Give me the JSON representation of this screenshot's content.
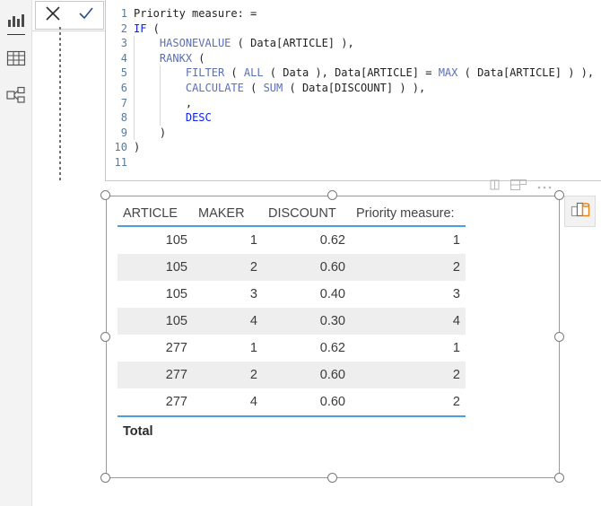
{
  "view_rail": {
    "items": [
      {
        "name": "report-view",
        "icon": "bar-chart-icon",
        "label": "Report",
        "selected": true
      },
      {
        "name": "data-view",
        "icon": "table-grid-icon",
        "label": "Data",
        "selected": false
      },
      {
        "name": "model-view",
        "icon": "model-relationships-icon",
        "label": "Model",
        "selected": false
      }
    ]
  },
  "formula_bar": {
    "cancel_label": "✕",
    "commit_label": "✓",
    "cancel_icon": "close-x-icon",
    "commit_icon": "checkmark-icon",
    "lines": [
      {
        "n": "1",
        "text": "Priority measure: ="
      },
      {
        "n": "2",
        "text": "IF ("
      },
      {
        "n": "3",
        "text": "    HASONEVALUE ( Data[ARTICLE] ),"
      },
      {
        "n": "4",
        "text": "    RANKX ("
      },
      {
        "n": "5",
        "text": "        FILTER ( ALL ( Data ), Data[ARTICLE] = MAX ( Data[ARTICLE] ) ),"
      },
      {
        "n": "6",
        "text": "        CALCULATE ( SUM ( Data[DISCOUNT] ) ),"
      },
      {
        "n": "7",
        "text": "        ,"
      },
      {
        "n": "8",
        "text": "        DESC"
      },
      {
        "n": "9",
        "text": "    )"
      },
      {
        "n": "10",
        "text": ")"
      },
      {
        "n": "11",
        "text": ""
      }
    ],
    "measure_name": "Priority measure:"
  },
  "visual_header": {
    "icons": [
      {
        "name": "filter-icon",
        "label": "Filters"
      },
      {
        "name": "focus-mode-icon",
        "label": "Focus mode"
      },
      {
        "name": "more-options-icon",
        "label": "More options"
      }
    ]
  },
  "focus_button": {
    "name": "focus-mode-button",
    "icon": "chart-focus-icon",
    "label": "Focus mode"
  },
  "table_visual": {
    "columns": [
      "ARTICLE",
      "MAKER",
      "DISCOUNT",
      "Priority measure:"
    ],
    "rows": [
      [
        "105",
        "1",
        "0.62",
        "1"
      ],
      [
        "105",
        "2",
        "0.60",
        "2"
      ],
      [
        "105",
        "3",
        "0.40",
        "3"
      ],
      [
        "105",
        "4",
        "0.30",
        "4"
      ],
      [
        "277",
        "1",
        "0.62",
        "1"
      ],
      [
        "277",
        "2",
        "0.60",
        "2"
      ],
      [
        "277",
        "4",
        "0.60",
        "2"
      ]
    ],
    "total_label": "Total",
    "total_values": [
      "",
      "",
      "",
      ""
    ]
  },
  "colors": {
    "accent_blue": "#4a9fe0",
    "keyword_blue": "#0b20f0",
    "function_blue": "#5b6fb5",
    "gutter_blue": "#5a7a9a",
    "rail_bg": "#f3f3f3",
    "alt_row": "#eeeeee",
    "orange": "#e8851a"
  }
}
